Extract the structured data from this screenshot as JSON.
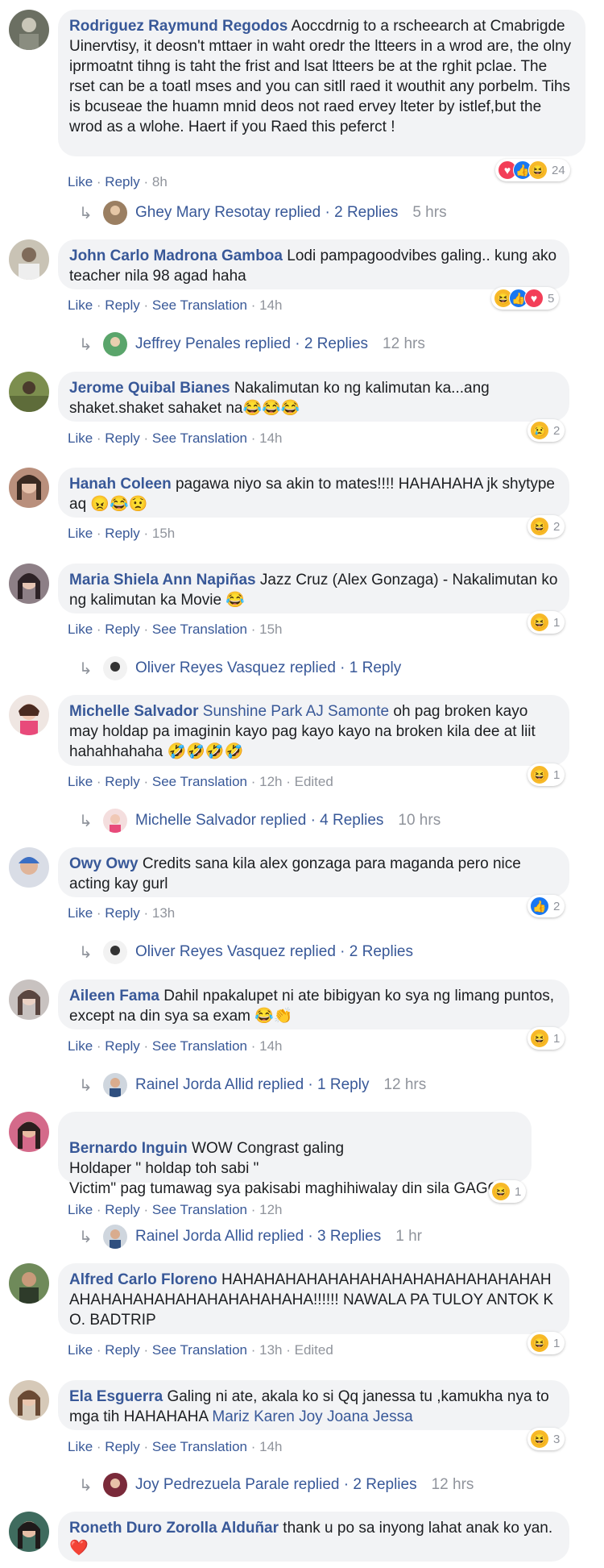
{
  "colors": {
    "link": "#385898",
    "meta": "#90949c",
    "bubble": "#f2f3f5",
    "like": "#1877f2",
    "love": "#f33e58",
    "haha": "#f7b928"
  },
  "actions": {
    "like": "Like",
    "reply": "Reply",
    "see_translation": "See Translation"
  },
  "comments": [
    {
      "author": "Rodriguez Raymund Regodos",
      "text": "Aoccdrnig to a rscheearch at Cmabrigde Uinervtisy, it deosn't mttaer in waht oredr the ltteers in a wrod are, the olny iprmoatnt tihng is taht the frist and lsat ltteers be at the rghit pclae. The rset can be a toatl mses and you can sitll raed it wouthit any porbelm. Tihs is bcuseae the huamn mnid deos not raed ervey lteter by istlef,but the wrod as a wlohe. Haert if you Raed this peferct !",
      "time": "8h",
      "reactions": {
        "icons": [
          "love-icon",
          "like-icon",
          "haha-icon"
        ],
        "count": "24"
      },
      "reply": {
        "name": "Ghey Mary Resotay",
        "label": "replied · 2 Replies",
        "time": "5 hrs"
      }
    },
    {
      "author": "John Carlo Madrona Gamboa",
      "text": "Lodi pampagoodvibes galing.. kung ako teacher nila 98 agad haha",
      "time": "14h",
      "reactions": {
        "icons": [
          "haha-icon",
          "like-icon",
          "love-icon"
        ],
        "count": "5"
      },
      "reply": {
        "name": "Jeffrey Penales",
        "label": "replied · 2 Replies",
        "time": "12 hrs"
      }
    },
    {
      "author": "Jerome Quibal Bianes",
      "text": "Nakalimutan ko ng kalimutan ka...ang shaket.shaket sahaket na😂😂😂",
      "time": "14h",
      "reactions": {
        "icons": [
          "sad-icon"
        ],
        "count": "2"
      }
    },
    {
      "author": "Hanah Coleen",
      "text": "pagawa niyo sa akin to mates!!!! HAHAHAHA jk shytype aq 😠😂😟",
      "time": "15h",
      "reactions": {
        "icons": [
          "haha-icon"
        ],
        "count": "2"
      }
    },
    {
      "author": "Maria Shiela Ann Napiñas",
      "text": "Jazz Cruz (Alex Gonzaga) - Nakalimutan ko ng kalimutan ka Movie 😂",
      "time": "15h",
      "reactions": {
        "icons": [
          "haha-icon"
        ],
        "count": "1"
      },
      "reply": {
        "name": "Oliver Reyes Vasquez",
        "label": "replied · 1 Reply",
        "time": ""
      }
    },
    {
      "author": "Michelle Salvador",
      "mention": "Sunshine Park AJ Samonte",
      "text": "oh pag broken kayo may holdap pa imaginin kayo pag kayo kayo na broken kila dee at liit hahahhahaha 🤣🤣🤣🤣",
      "time": "12h",
      "edited": "Edited",
      "reactions": {
        "icons": [
          "haha-icon"
        ],
        "count": "1"
      },
      "reply": {
        "name": "Michelle Salvador",
        "label": "replied · 4 Replies",
        "time": "10 hrs"
      }
    },
    {
      "author": "Owy Owy",
      "text": "Credits sana kila alex gonzaga para maganda pero nice acting kay gurl",
      "time": "13h",
      "reactions": {
        "icons": [
          "like-icon"
        ],
        "count": "2"
      },
      "reply": {
        "name": "Oliver Reyes Vasquez",
        "label": "replied · 2 Replies",
        "time": ""
      }
    },
    {
      "author": "Aileen Fama",
      "text": "Dahil npakalupet ni ate bibigyan ko sya ng limang puntos, except na din sya sa exam 😂👏",
      "time": "14h",
      "reactions": {
        "icons": [
          "haha-icon"
        ],
        "count": "1"
      },
      "reply": {
        "name": "Rainel Jorda Allid",
        "label": "replied · 1 Reply",
        "time": "12 hrs"
      }
    },
    {
      "author": "Bernardo Inguin",
      "text": "WOW Congrast galing\nHoldaper \" holdap toh sabi \"\nVictim\" pag tumawag sya pakisabi maghihiwalay din sila GAGO",
      "time": "12h",
      "reactions": {
        "icons": [
          "haha-icon"
        ],
        "count": "1"
      },
      "reply": {
        "name": "Rainel Jorda Allid",
        "label": "replied · 3 Replies",
        "time": "1 hr"
      }
    },
    {
      "author": "Alfred Carlo Floreno",
      "text": "HAHAHAHAHAHAHAHAHAHAHAHAHAHAHAHAHAHAHAHAHAHAHAHAHAHAHA!!!!!! NAWALA PA TULOY ANTOK KO. BADTRIP",
      "time": "13h",
      "edited": "Edited",
      "reactions": {
        "icons": [
          "haha-icon"
        ],
        "count": "1"
      }
    },
    {
      "author": "Ela Esguerra",
      "text": "Galing ni ate, akala ko si Qq janessa tu ,kamukha nya to mga tih HAHAHAHA",
      "mention_after": "Mariz Karen Joy Joana Jessa",
      "time": "14h",
      "reactions": {
        "icons": [
          "haha-icon"
        ],
        "count": "3"
      },
      "reply": {
        "name": "Joy Pedrezuela Parale",
        "label": "replied · 2 Replies",
        "time": "12 hrs"
      }
    },
    {
      "author": "Roneth Duro Zorolla Alduñar",
      "text": "thank u po sa inyong lahat anak ko yan.❤️"
    }
  ]
}
